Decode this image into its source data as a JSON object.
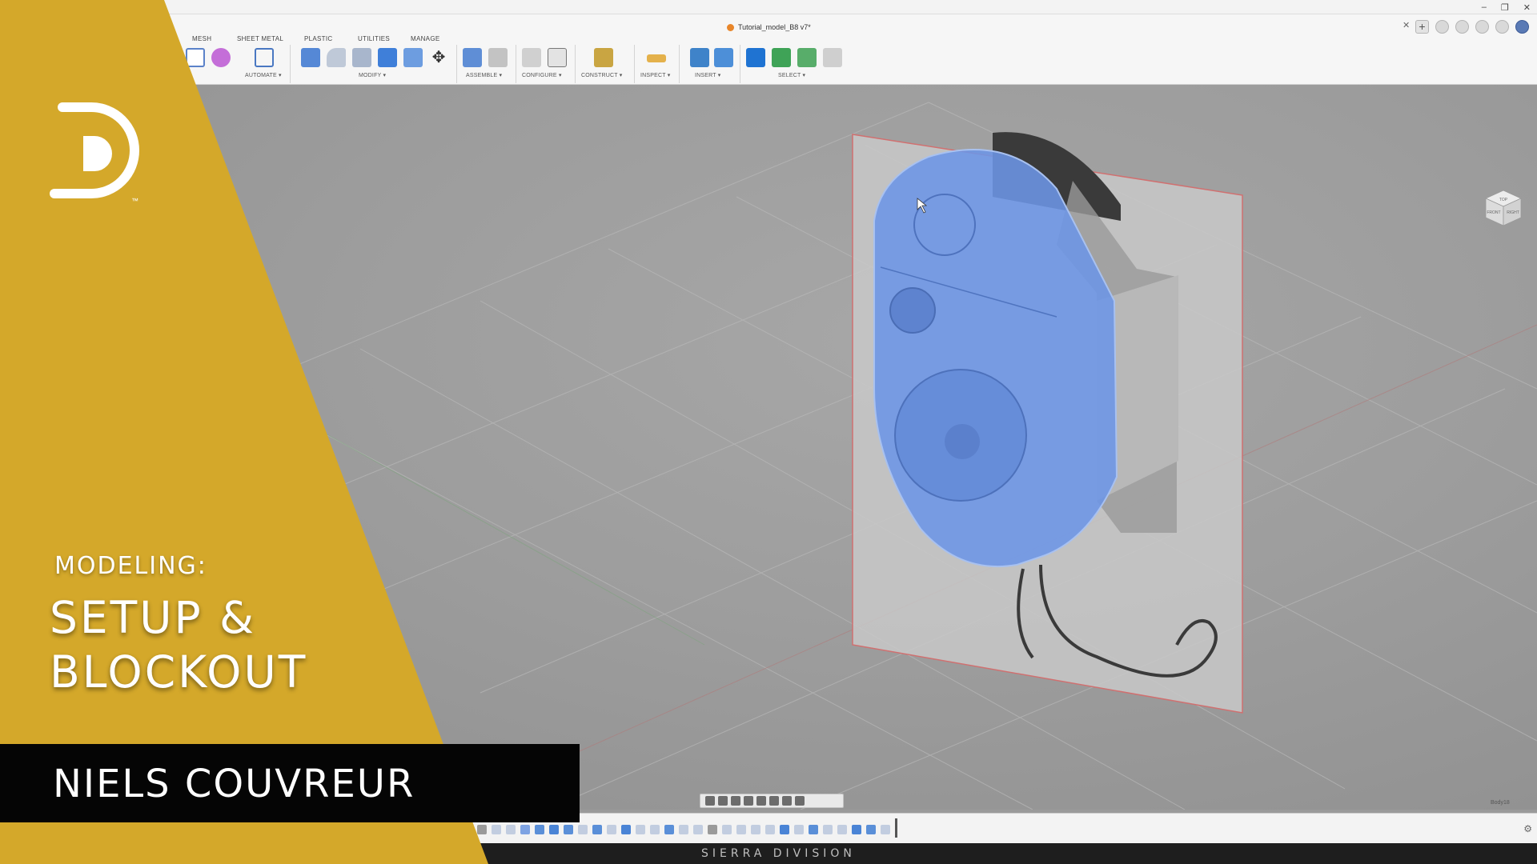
{
  "window": {
    "document_title": "Tutorial_model_B8 v7*",
    "close_tab": "✕",
    "controls": [
      "–",
      "❐",
      "✕"
    ]
  },
  "toolbar": {
    "tabs": [
      "MESH",
      "SHEET METAL",
      "PLASTIC",
      "UTILITIES",
      "MANAGE"
    ],
    "groups": [
      "AUTOMATE ▾",
      "MODIFY ▾",
      "ASSEMBLE ▾",
      "CONFIGURE ▾",
      "CONSTRUCT ▾",
      "INSPECT ▾",
      "INSERT ▾",
      "SELECT ▾"
    ]
  },
  "viewport": {
    "body_label": "Body18",
    "viewcube_labels": [
      "TOP",
      "FRONT",
      "RIGHT"
    ]
  },
  "overlay": {
    "subtitle": "MODELING:",
    "title_line1": "SETUP &",
    "title_line2": "BLOCKOUT",
    "author": "NIELS COUVREUR",
    "logo_tm": "™",
    "brand": "SIERRA DIVISION"
  },
  "colors": {
    "gold": "#d4a82a",
    "selection_blue": "#6c95e6",
    "canvas_plane": "#c8c8c8",
    "background": "#9a9a9a"
  }
}
